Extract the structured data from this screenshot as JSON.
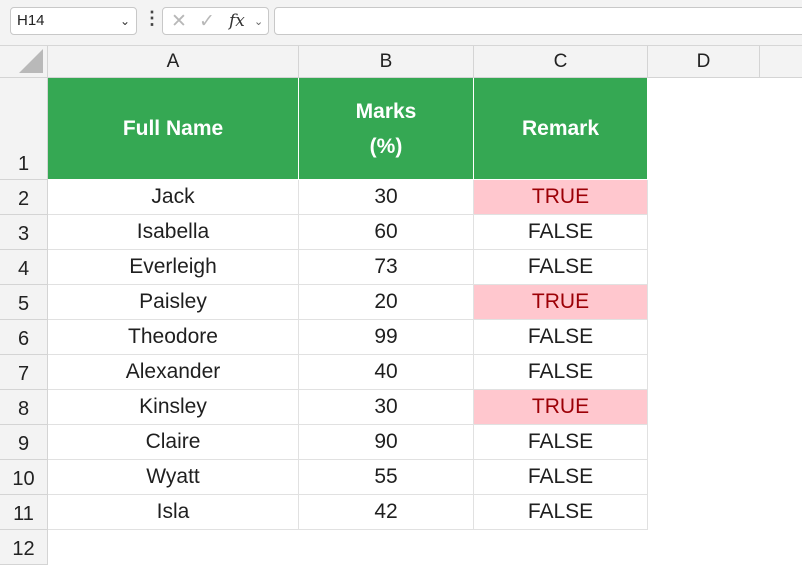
{
  "name_box": {
    "value": "H14"
  },
  "formula_bar": {
    "cancel_glyph": "✕",
    "enter_glyph": "✓",
    "fx_label": "fx",
    "value": ""
  },
  "columns": [
    "A",
    "B",
    "C",
    "D"
  ],
  "header_row": {
    "full_name": "Full Name",
    "marks": "Marks",
    "marks_unit": "(%)",
    "remark": "Remark"
  },
  "row_numbers": [
    "1",
    "2",
    "3",
    "4",
    "5",
    "6",
    "7",
    "8",
    "9",
    "10",
    "11",
    "12"
  ],
  "rows": [
    {
      "name": "Jack",
      "marks": "30",
      "remark": "TRUE"
    },
    {
      "name": "Isabella",
      "marks": "60",
      "remark": "FALSE"
    },
    {
      "name": "Everleigh",
      "marks": "73",
      "remark": "FALSE"
    },
    {
      "name": "Paisley",
      "marks": "20",
      "remark": "TRUE"
    },
    {
      "name": "Theodore",
      "marks": "99",
      "remark": "FALSE"
    },
    {
      "name": "Alexander",
      "marks": "40",
      "remark": "FALSE"
    },
    {
      "name": "Kinsley",
      "marks": "30",
      "remark": "TRUE"
    },
    {
      "name": "Claire",
      "marks": "90",
      "remark": "FALSE"
    },
    {
      "name": "Wyatt",
      "marks": "55",
      "remark": "FALSE"
    },
    {
      "name": "Isla",
      "marks": "42",
      "remark": "FALSE"
    }
  ],
  "colors": {
    "header_fill": "#35a853",
    "true_fill": "#ffc7ce",
    "true_text": "#9c0006"
  }
}
